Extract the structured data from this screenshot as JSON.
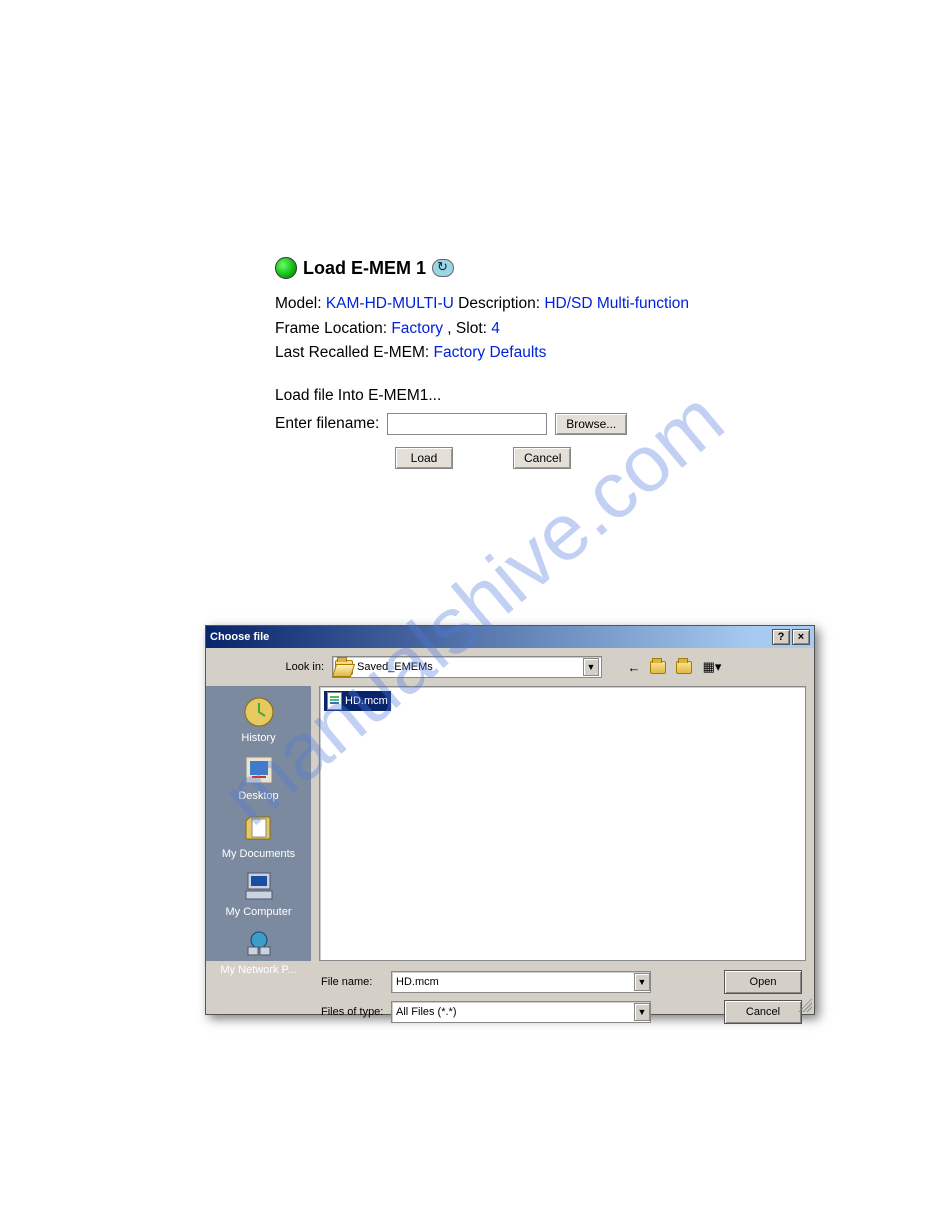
{
  "watermark": "manualshive.com",
  "panel": {
    "title": "Load E-MEM 1",
    "labels": {
      "model": "Model: ",
      "description": " Description: ",
      "frame_location": "Frame Location: ",
      "slot": " , Slot: ",
      "last_recalled": "Last Recalled E-MEM: ",
      "load_file": "Load file Into E-MEM1...",
      "enter_filename": "Enter filename: "
    },
    "values": {
      "model": "KAM-HD-MULTI-U",
      "description": "HD/SD Multi-function",
      "frame_location": "Factory",
      "slot": "4",
      "last_recalled": "Factory Defaults",
      "filename": ""
    },
    "buttons": {
      "browse": "Browse...",
      "load": "Load",
      "cancel": "Cancel"
    }
  },
  "dialog": {
    "title": "Choose file",
    "lookin_label": "Look in:",
    "lookin_value": "Saved_EMEMs",
    "sidebar": [
      {
        "label": "History",
        "icon": "history"
      },
      {
        "label": "Desktop",
        "icon": "desktop"
      },
      {
        "label": "My Documents",
        "icon": "documents"
      },
      {
        "label": "My Computer",
        "icon": "computer"
      },
      {
        "label": "My Network P...",
        "icon": "network"
      }
    ],
    "files": [
      {
        "name": "HD.mcm",
        "selected": true
      }
    ],
    "filename_label": "File name:",
    "filename_value": "HD.mcm",
    "filetype_label": "Files of type:",
    "filetype_value": "All Files (*.*)",
    "buttons": {
      "open": "Open",
      "cancel": "Cancel"
    },
    "toolbar_icons": [
      "back",
      "up-one-level",
      "new-folder",
      "views"
    ]
  }
}
